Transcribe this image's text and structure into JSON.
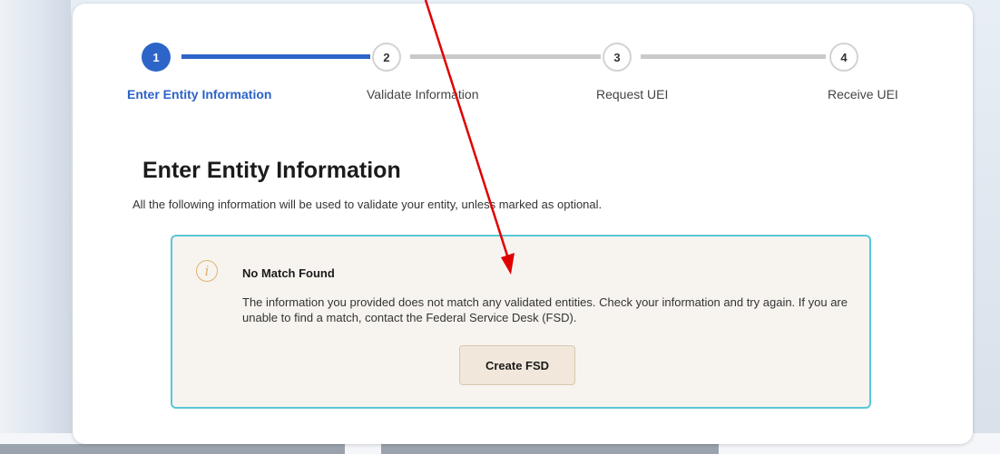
{
  "stepper": {
    "steps": [
      {
        "number": "1",
        "label": "Enter Entity Information",
        "state": "active"
      },
      {
        "number": "2",
        "label": "Validate Information",
        "state": "inactive"
      },
      {
        "number": "3",
        "label": "Request UEI",
        "state": "inactive"
      },
      {
        "number": "4",
        "label": "Receive UEI",
        "state": "inactive"
      }
    ]
  },
  "main": {
    "title": "Enter Entity Information",
    "subtitle": "All the following information will be used to validate your entity, unless marked as optional."
  },
  "alert": {
    "icon": "info-icon",
    "icon_glyph": "i",
    "title": "No Match Found",
    "body": "The information you provided does not match any validated entities. Check your information and try again. If you are unable to find a match, contact the Federal Service Desk (FSD).",
    "button_label": "Create FSD"
  },
  "colors": {
    "accent": "#2d64c8",
    "alert_border": "#58c7d8",
    "alert_background": "#f7f4ef",
    "annotation_arrow": "#e00000"
  }
}
